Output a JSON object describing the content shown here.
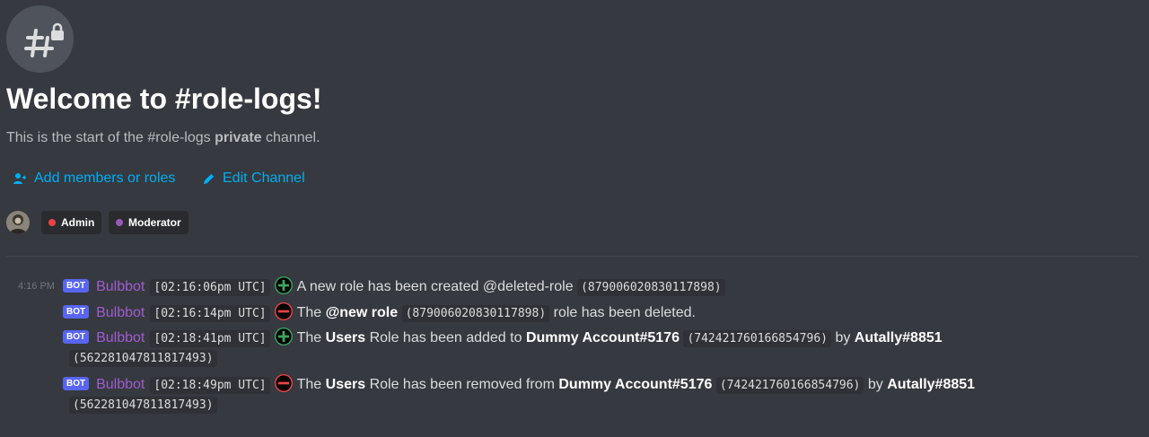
{
  "header": {
    "icon": "hash-lock-icon",
    "title": "Welcome to #role-logs!",
    "subtitle_prefix": "This is the start of the #role-logs",
    "subtitle_bold": "private",
    "subtitle_suffix": "channel."
  },
  "actions": {
    "add_members": "Add members or roles",
    "edit_channel": "Edit Channel"
  },
  "roles": [
    {
      "name": "Admin",
      "color": "#ed4245"
    },
    {
      "name": "Moderator",
      "color": "#9b59b6"
    }
  ],
  "messages": {
    "time": "4:16 PM",
    "bot_tag": "BOT",
    "author": "Bulbbot",
    "m1": {
      "timestamp": "[02:16:06pm UTC]",
      "text": "A new role has been created @deleted-role",
      "code": "(879006020830117898)",
      "icon": "plus-circle-icon"
    },
    "m2": {
      "timestamp": "[02:16:14pm UTC]",
      "text_prefix": "The",
      "role": "@new role",
      "code": "(879006020830117898)",
      "text_suffix": "role has been deleted.",
      "icon": "minus-circle-icon"
    },
    "m3": {
      "timestamp": "[02:18:41pm UTC]",
      "text_prefix": "The",
      "role": "Users",
      "text_mid": "Role has been added to",
      "user": "Dummy Account#5176",
      "user_id": "(742421760166854796)",
      "by": "by",
      "mod": "Autally#8851",
      "mod_id": "(562281047811817493)",
      "icon": "plus-circle-icon"
    },
    "m4": {
      "timestamp": "[02:18:49pm UTC]",
      "text_prefix": "The",
      "role": "Users",
      "text_mid": "Role has been removed from",
      "user": "Dummy Account#5176",
      "user_id": "(742421760166854796)",
      "by": "by",
      "mod": "Autally#8851",
      "mod_id": "(562281047811817493)",
      "icon": "minus-circle-icon"
    }
  },
  "colors": {
    "background": "#36393f",
    "link": "#00aff4",
    "bot_tag": "#5865f2",
    "author": "#a35ad6",
    "plus": "#3ba55d",
    "minus": "#ed4245"
  }
}
